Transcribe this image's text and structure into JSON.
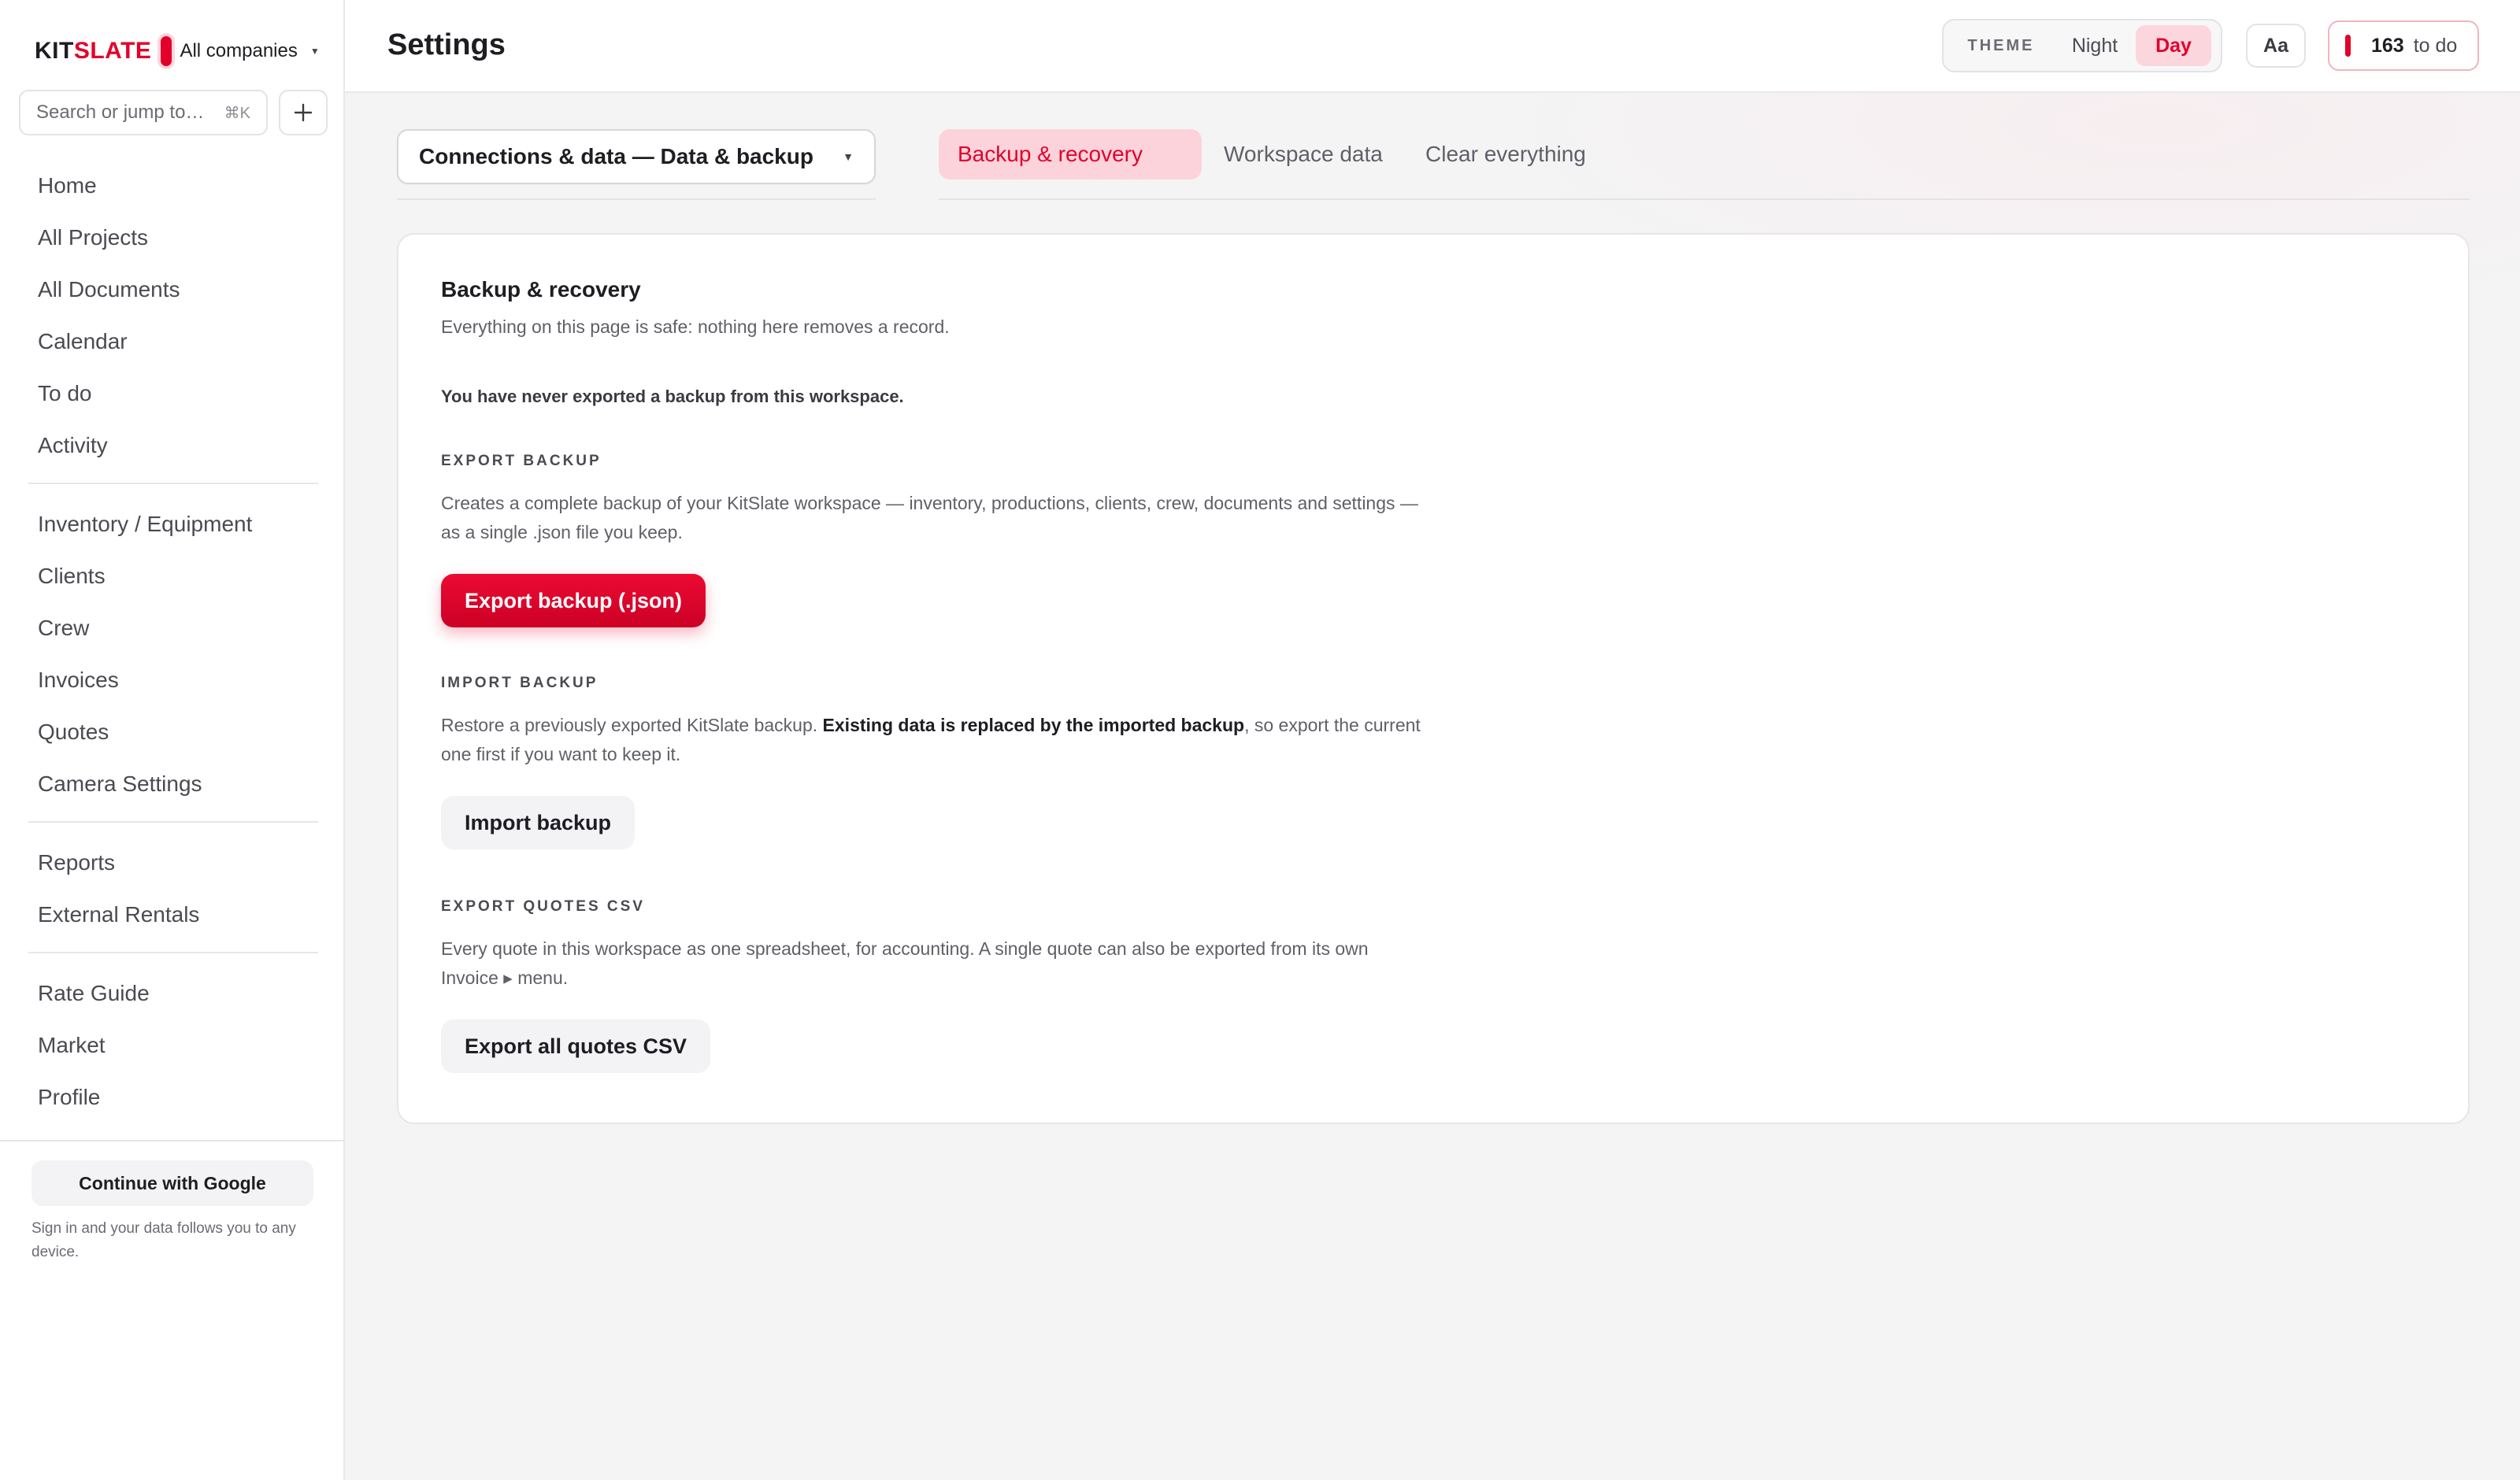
{
  "brand": {
    "logo_part1": "KIT",
    "logo_part2": "SLATE",
    "company_label": "All companies",
    "accent_color": "#e2002a"
  },
  "search": {
    "placeholder": "Search or jump to…",
    "shortcut": "⌘K"
  },
  "sidebar": {
    "group1": [
      "Home",
      "All Projects",
      "All Documents",
      "Calendar",
      "To do",
      "Activity"
    ],
    "group2": [
      "Inventory / Equipment",
      "Clients",
      "Crew",
      "Invoices",
      "Quotes",
      "Camera Settings"
    ],
    "group3": [
      "Reports",
      "External Rentals"
    ],
    "group4": [
      "Rate Guide",
      "Market",
      "Profile"
    ],
    "google_button": "Continue with Google",
    "google_note": "Sign in and your data follows you to any device."
  },
  "header": {
    "title": "Settings",
    "theme_label": "THEME",
    "theme_options": [
      "Night",
      "Day"
    ],
    "theme_selected": "Day",
    "font_button": "Aa",
    "todo_count": "163",
    "todo_label": "to do"
  },
  "section_select": {
    "value": "Connections & data — Data & backup"
  },
  "tabs": [
    "Backup & recovery",
    "Workspace data",
    "Clear everything"
  ],
  "active_tab": "Backup & recovery",
  "card": {
    "title": "Backup & recovery",
    "subtitle": "Everything on this page is safe: nothing here removes a record.",
    "status_note": "You have never exported a backup from this workspace.",
    "export": {
      "heading": "EXPORT BACKUP",
      "description": "Creates a complete backup of your KitSlate workspace — inventory, productions, clients, crew, documents and settings — as a single .json file you keep.",
      "button": "Export backup (.json)"
    },
    "import": {
      "heading": "IMPORT BACKUP",
      "description_before": "Restore a previously exported KitSlate backup. ",
      "description_bold": "Existing data is replaced by the imported backup",
      "description_after": ", so export the current one first if you want to keep it.",
      "button": "Import backup"
    },
    "csv": {
      "heading": "EXPORT QUOTES CSV",
      "description": "Every quote in this workspace as one spreadsheet, for accounting. A single quote can also be exported from its own Invoice ▸ menu.",
      "button": "Export all quotes CSV"
    }
  },
  "icons": {
    "add": "plus-icon",
    "caret": "chevron-down-icon"
  }
}
